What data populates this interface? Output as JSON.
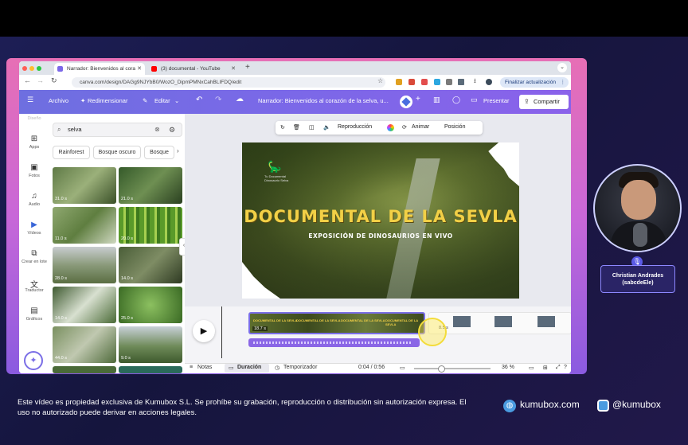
{
  "browser": {
    "tabs": [
      {
        "label": "Narrador: Bienvenidos al cora"
      },
      {
        "label": "(3) documental - YouTube"
      }
    ],
    "new_tab": "+",
    "url": "canva.com/design/DAGg9NJYbB0/WozO_DipmPMNxCahBLIFDQ/edit",
    "update_label": "Finalizar actualización"
  },
  "toolbar": {
    "menu": "☰",
    "file": "Archivo",
    "resize": "Redimensionar",
    "edit": "Editar",
    "doc_title": "Narrador: Bienvenidos al corazón de la selva, u...",
    "present": "Presentar",
    "share": "Compartir"
  },
  "sidebar": {
    "items": [
      {
        "label": "Diseño"
      },
      {
        "label": "Apps"
      },
      {
        "label": "Fotos"
      },
      {
        "label": "Audio"
      },
      {
        "label": "Vídeos"
      },
      {
        "label": "Crear en lote"
      },
      {
        "label": "Traductor"
      },
      {
        "label": "Gráficos"
      }
    ]
  },
  "panel": {
    "search_value": "selva",
    "chips": [
      {
        "label": "Rainforest"
      },
      {
        "label": "Bosque oscuro"
      },
      {
        "label": "Bosque"
      }
    ],
    "durations": [
      "31.0 s",
      "21.0 s",
      "11.0 s",
      "20.0 s",
      "28.0 s",
      "14.0 s",
      "14.0 s",
      "25.0 s",
      "44.0 s",
      "9.0 s"
    ]
  },
  "context_bar": {
    "playback": "Reproducción",
    "animate": "Animar",
    "position": "Posición"
  },
  "slide": {
    "logo_text": "Tu Documental\nDinosaurio Selva",
    "title": "DOCUMENTAL DE LA SEVLA",
    "subtitle": "EXPOSICIÓN DE DINOSAURIOS EN VIVO"
  },
  "timeline": {
    "clip_duration": "18.7 s",
    "next_duration": "8.5 s",
    "clip_label": "DOCUMENTAL DE LA SEVLA"
  },
  "bottombar": {
    "notes": "Notas",
    "duration": "Duración",
    "timer": "Temporizador",
    "time": "0:04 / 0:56",
    "zoom": "36 %"
  },
  "presenter": {
    "name": "Christian Andrades",
    "handle": "(sabcdeEle)"
  },
  "footer": {
    "notice": "Este vídeo es propiedad exclusiva de Kumubox S.L. Se prohíbe su grabación, reproducción o distribución sin autorización expresa. El uso no autorizado puede derivar en acciones legales.",
    "website": "kumubox.com",
    "instagram": "@kumubox"
  },
  "colors": {
    "accent": "#7b68e8",
    "brand_pink": "#e76fb5",
    "title_yellow": "#f2d046"
  }
}
